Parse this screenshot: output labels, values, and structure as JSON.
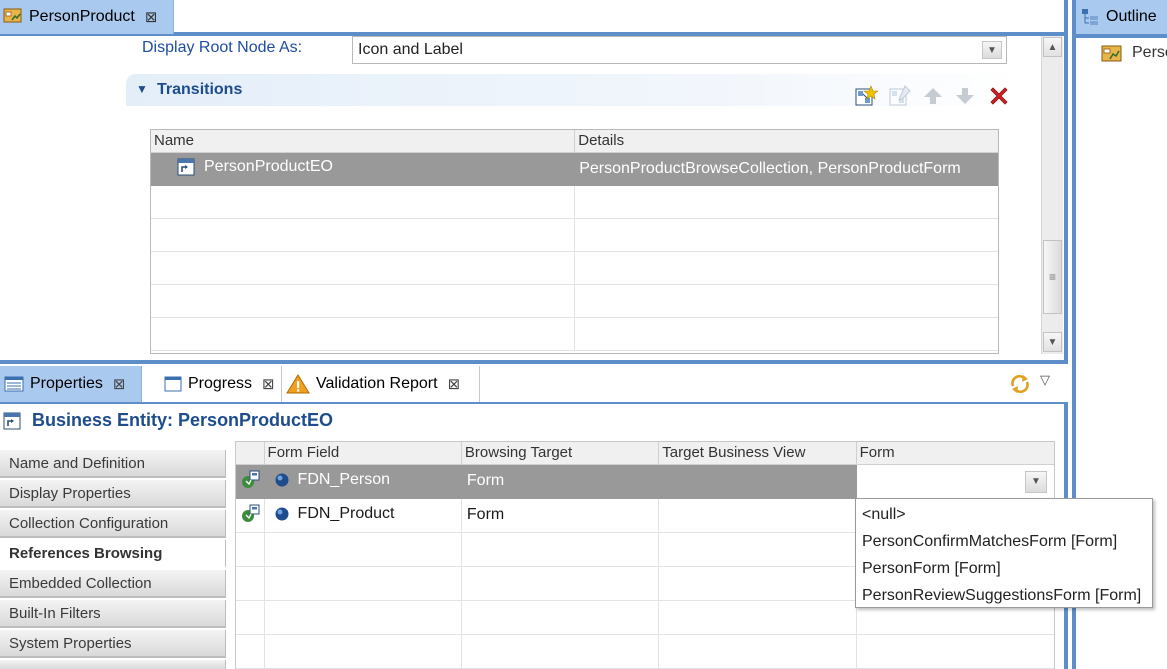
{
  "editor": {
    "tab": {
      "label": "PersonProduct"
    },
    "display_root": {
      "label": "Display Root Node As:",
      "value": "Icon and Label"
    },
    "transitions": {
      "title": "Transitions",
      "columns": [
        "Name",
        "Details"
      ],
      "rows": [
        {
          "name": "PersonProductEO",
          "details": "PersonProductBrowseCollection, PersonProductForm"
        }
      ]
    }
  },
  "outline": {
    "tab": {
      "label": "Outline"
    },
    "item": "Perso"
  },
  "properties": {
    "tabs": [
      {
        "label": "Properties"
      },
      {
        "label": "Progress"
      },
      {
        "label": "Validation Report"
      }
    ],
    "entity_title": "Business Entity: PersonProductEO",
    "nav": [
      {
        "label": "Name and Definition"
      },
      {
        "label": "Display Properties"
      },
      {
        "label": "Collection Configuration"
      },
      {
        "label": "References Browsing"
      },
      {
        "label": "Embedded Collection"
      },
      {
        "label": "Built-In Filters"
      },
      {
        "label": "System Properties"
      }
    ],
    "references": {
      "columns": [
        "Form Field",
        "Browsing Target",
        "Target Business View",
        "Form"
      ],
      "rows": [
        {
          "field": "FDN_Person",
          "target": "Form",
          "view": "",
          "form": ""
        },
        {
          "field": "FDN_Product",
          "target": "Form",
          "view": "",
          "form": ""
        }
      ]
    },
    "form_dropdown": {
      "options": [
        "<null>",
        "PersonConfirmMatchesForm [Form]",
        "PersonForm [Form]",
        "PersonReviewSuggestionsForm [Form]"
      ]
    }
  },
  "colors": {
    "accent": "#5e8ec9",
    "tab_active": "#a9c9ee",
    "section_title": "#1d4d8c",
    "selected_row": "#999999",
    "delete": "#d02020"
  }
}
